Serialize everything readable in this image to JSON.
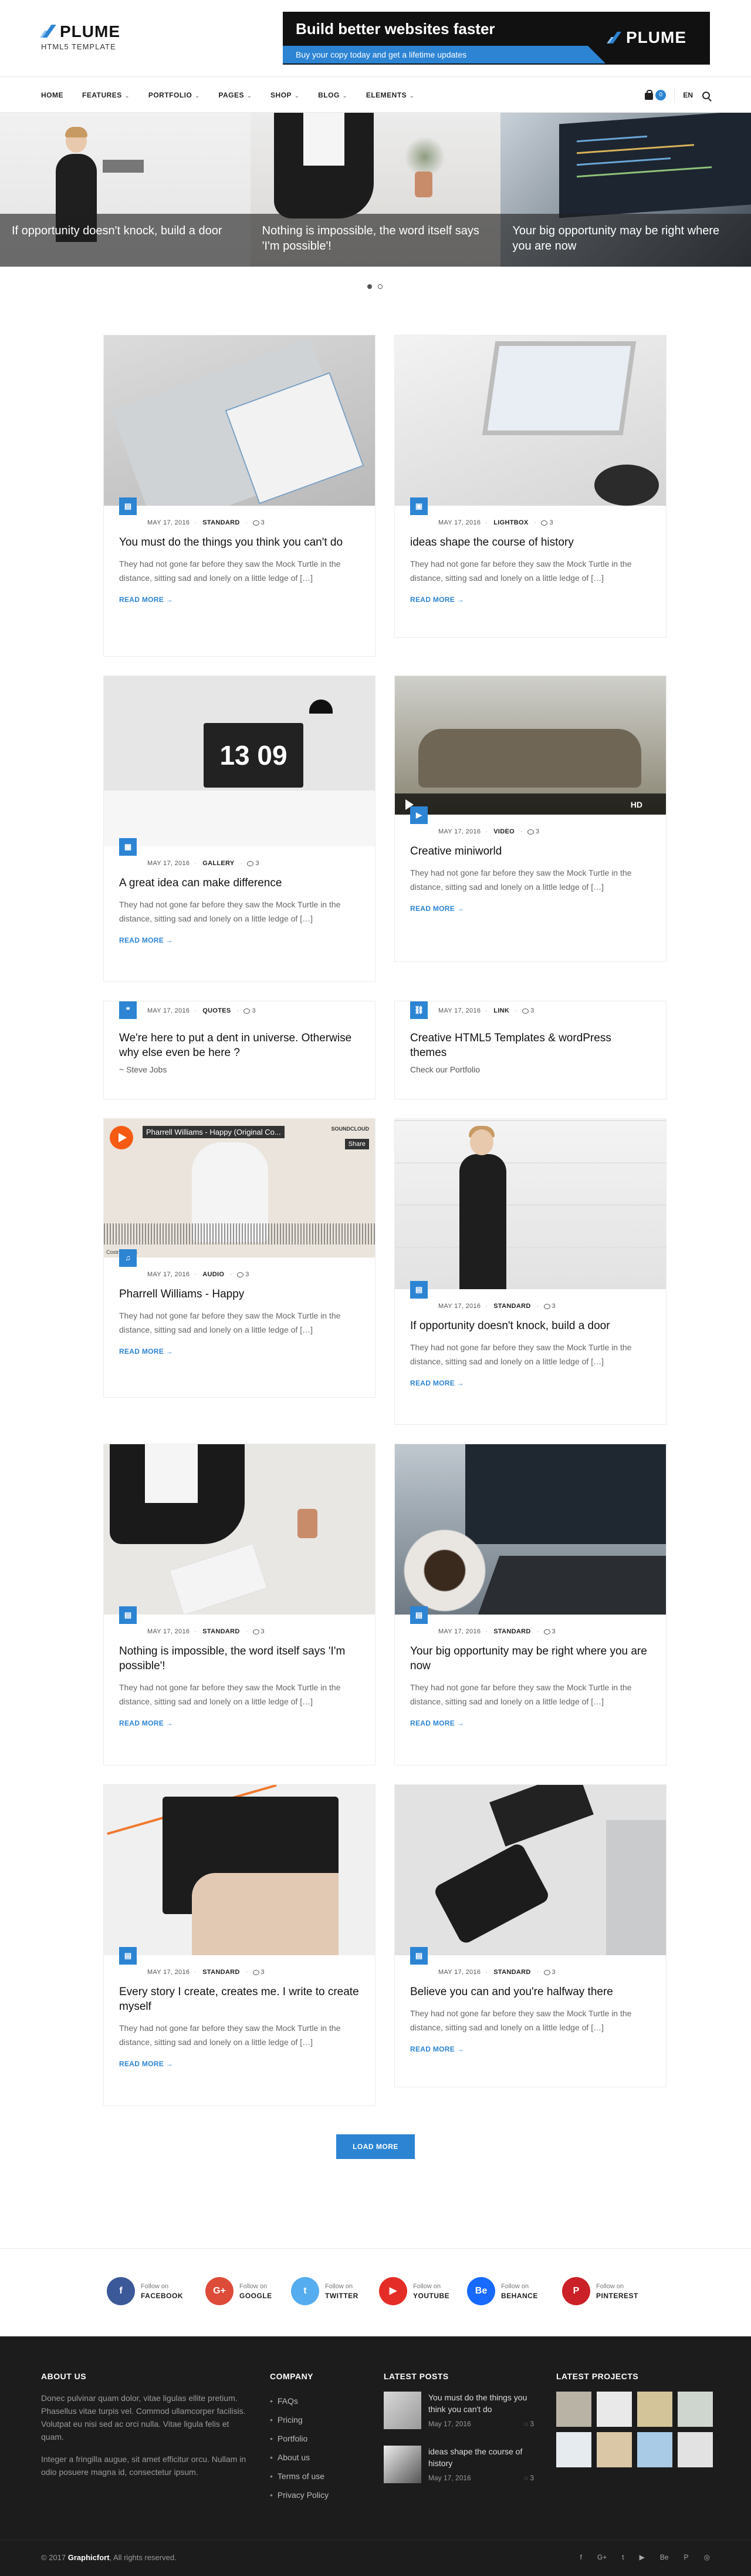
{
  "header": {
    "logo": "PLUME",
    "tagline": "HTML5 TEMPLATE",
    "banner": {
      "title": "Build better websites faster",
      "subtitle": "Buy your copy today and get a lifetime updates",
      "logo": "PLUME"
    }
  },
  "nav": {
    "items": [
      "HOME",
      "FEATURES",
      "PORTFOLIO",
      "PAGES",
      "SHOP",
      "BLOG",
      "ELEMENTS"
    ],
    "cart_count": "0",
    "lang": "EN"
  },
  "slider": {
    "captions": [
      "If opportunity doesn't knock, build a door",
      "Nothing is impossible, the word itself says 'I'm possible'!",
      "Your big opportunity may be right where you are now"
    ]
  },
  "posts": [
    {
      "date": "MAY 17, 2016",
      "type": "STANDARD",
      "comments": "3",
      "title": "You must do the things you think you can't do",
      "excerpt": "They had not gone far before they saw the Mock Turtle in the distance, sitting sad and lonely on a little ledge of […]",
      "more": "READ MORE →"
    },
    {
      "date": "MAY 17, 2016",
      "type": "LIGHTBOX",
      "comments": "3",
      "title": "ideas shape the course of history",
      "excerpt": "They had not gone far before they saw the Mock Turtle in the distance, sitting sad and lonely on a little ledge of […]",
      "more": "READ MORE →"
    },
    {
      "date": "MAY 17, 2016",
      "type": "GALLERY",
      "comments": "3",
      "title": "A great idea can make difference",
      "excerpt": "They had not gone far before they saw the Mock Turtle in the distance, sitting sad and lonely on a little ledge of […]",
      "more": "READ MORE →",
      "clock": "13 09"
    },
    {
      "date": "MAY 17, 2016",
      "type": "VIDEO",
      "comments": "3",
      "title": "Creative miniworld",
      "excerpt": "They had not gone far before they saw the Mock Turtle in the distance, sitting sad and lonely on a little ledge of […]",
      "more": "READ MORE →",
      "hd": "HD"
    },
    {
      "date": "MAY 17, 2016",
      "type": "QUOTES",
      "comments": "3",
      "title": "We're here to put a dent in universe. Otherwise why else even be here ?",
      "author": "~ Steve Jobs"
    },
    {
      "date": "MAY 17, 2016",
      "type": "LINK",
      "comments": "3",
      "title": "Creative HTML5 Templates & wordPress themes",
      "link": "Check our Portfolio"
    },
    {
      "date": "MAY 17, 2016",
      "type": "AUDIO",
      "comments": "3",
      "title": "Pharrell Williams - Happy",
      "excerpt": "They had not gone far before they saw the Mock Turtle in the distance, sitting sad and lonely on a little ledge of […]",
      "more": "READ MORE →",
      "track": "Pharrell Williams - Happy (Original Co...",
      "player": "SOUNDCLOUD",
      "share": "Share",
      "caption": "Costra Jerins"
    },
    {
      "date": "MAY 17, 2016",
      "type": "STANDARD",
      "comments": "3",
      "title": "If opportunity doesn't knock, build a door",
      "excerpt": "They had not gone far before they saw the Mock Turtle in the distance, sitting sad and lonely on a little ledge of […]",
      "more": "READ MORE →"
    },
    {
      "date": "MAY 17, 2016",
      "type": "STANDARD",
      "comments": "3",
      "title": "Nothing is impossible, the word itself says 'I'm possible'!",
      "excerpt": "They had not gone far before they saw the Mock Turtle in the distance, sitting sad and lonely on a little ledge of […]",
      "more": "READ MORE →"
    },
    {
      "date": "MAY 17, 2016",
      "type": "STANDARD",
      "comments": "3",
      "title": "Your big opportunity may be right where you are now",
      "excerpt": "They had not gone far before they saw the Mock Turtle in the distance, sitting sad and lonely on a little ledge of […]",
      "more": "READ MORE →"
    },
    {
      "date": "MAY 17, 2016",
      "type": "STANDARD",
      "comments": "3",
      "title": "Every story I create, creates me. I write to create myself",
      "excerpt": "They had not gone far before they saw the Mock Turtle in the distance, sitting sad and lonely on a little ledge of […]",
      "more": "READ MORE →"
    },
    {
      "date": "MAY 17, 2016",
      "type": "STANDARD",
      "comments": "3",
      "title": "Believe you can and you're halfway there",
      "excerpt": "They had not gone far before they saw the Mock Turtle in the distance, sitting sad and lonely on a little ledge of […]",
      "more": "READ MORE →"
    }
  ],
  "load_more": "LOAD MORE",
  "social": [
    {
      "pre": "Follow on",
      "name": "FACEBOOK",
      "glyph": "f",
      "color": "#3b5998"
    },
    {
      "pre": "Follow on",
      "name": "GOOGLE",
      "glyph": "G+",
      "color": "#dd4b39"
    },
    {
      "pre": "Follow on",
      "name": "TWITTER",
      "glyph": "t",
      "color": "#55acee"
    },
    {
      "pre": "Follow on",
      "name": "YOUTUBE",
      "glyph": "▶",
      "color": "#e52d27"
    },
    {
      "pre": "Follow on",
      "name": "BEHANCE",
      "glyph": "Be",
      "color": "#1769ff"
    },
    {
      "pre": "Follow on",
      "name": "PINTEREST",
      "glyph": "P",
      "color": "#cb2027"
    }
  ],
  "footer": {
    "about": {
      "title": "ABOUT US",
      "p1": "Donec pulvinar quam dolor, vitae ligulas ellite pretium. Phasellus vitae turpis vel. Commod ullamcorper facilisis. Volutpat eu nisi sed ac orci nulla. Vitae ligula felis et quam.",
      "p2": "Integer a fringilla augue, sit amet efficitur orcu. Nullam in odio posuere magna id, consectetur ipsum."
    },
    "company": {
      "title": "COMPANY",
      "links": [
        "FAQs",
        "Pricing",
        "Portfolio",
        "About us",
        "Terms of use",
        "Privacy Policy"
      ]
    },
    "latest": {
      "title": "LATEST POSTS",
      "posts": [
        {
          "title": "You must do the things you think you can't do",
          "date": "May 17, 2016",
          "comments": "3"
        },
        {
          "title": "ideas shape the course of history",
          "date": "May 17, 2016",
          "comments": "3"
        }
      ]
    },
    "projects": {
      "title": "LATEST PROJECTS"
    },
    "copyright_pre": "© 2017 ",
    "copyright_brand": "Graphicfort",
    "copyright_post": ", All rights reserved.",
    "social_icons": [
      "f",
      "G+",
      "t",
      "▶",
      "Be",
      "P",
      "◎"
    ]
  }
}
